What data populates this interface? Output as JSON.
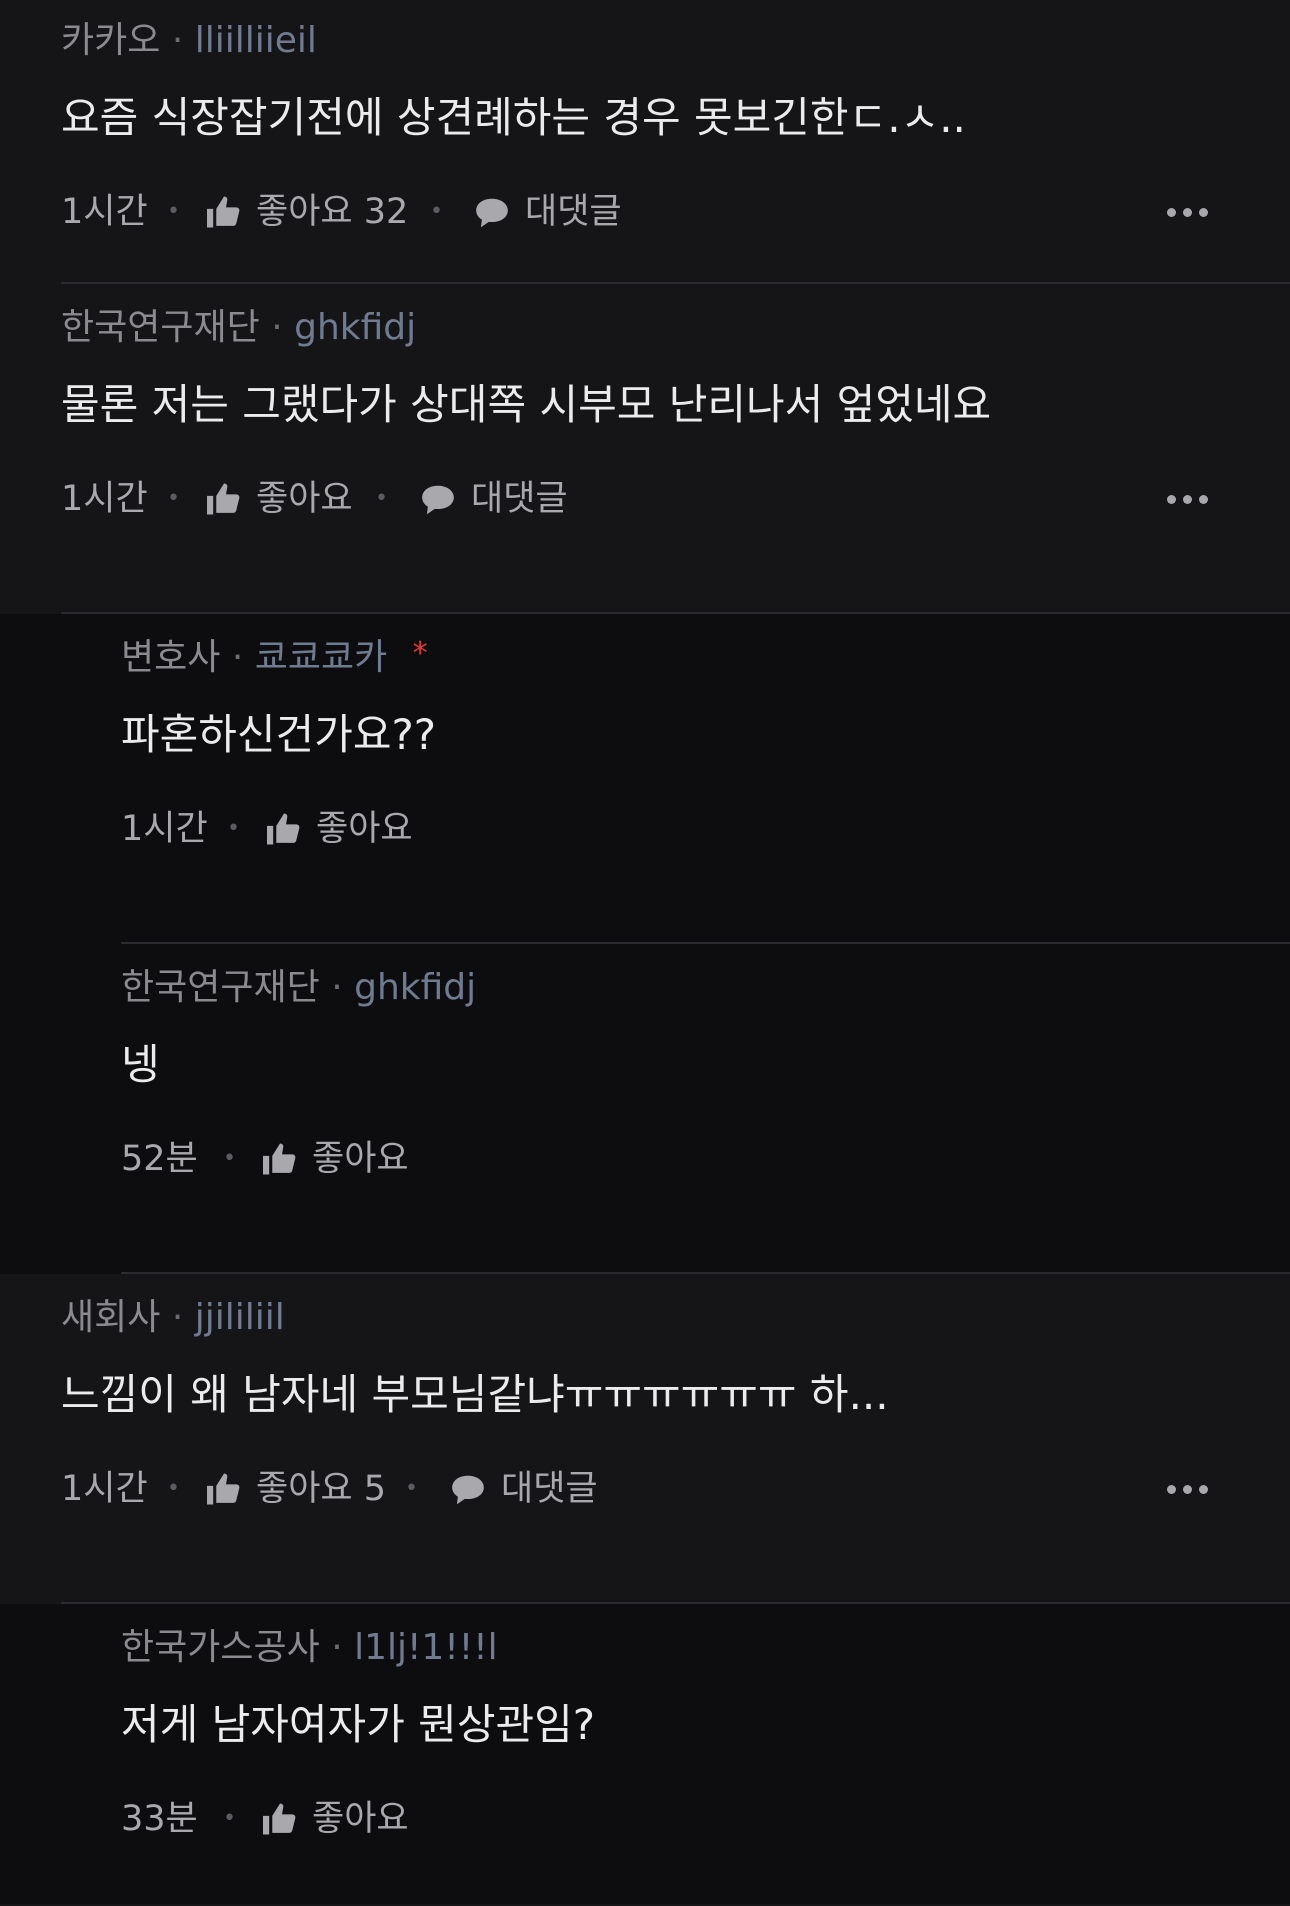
{
  "comments": [
    {
      "company": "카카오",
      "nickname": "lliilliieil",
      "text": "요즘 식장잡기전에 상견례하는 경우 못보긴한ㄷ.ㅅ..",
      "time": "1시간",
      "like_label": "좋아요 32",
      "reply_label": "대댓글"
    },
    {
      "company": "한국연구재단",
      "nickname": "ghkfidj",
      "text": "물론 저는 그랬다가 상대쪽 시부모 난리나서 엎었네요",
      "time": "1시간",
      "like_label": "좋아요",
      "reply_label": "대댓글"
    },
    {
      "company": "변호사",
      "nickname": "쿄쿄쿄카",
      "author_mark": "*",
      "text": "파혼하신건가요??",
      "time": "1시간",
      "like_label": "좋아요"
    },
    {
      "company": "한국연구재단",
      "nickname": "ghkfidj",
      "text": "넹",
      "time": "52분",
      "like_label": "좋아요"
    },
    {
      "company": "새회사",
      "nickname": "jjililiil",
      "text": "느낌이 왜 남자네 부모님같냐ㅠㅠㅠㅠㅠㅠ 하...",
      "time": "1시간",
      "like_label": "좋아요 5",
      "reply_label": "대댓글"
    },
    {
      "company": "한국가스공사",
      "nickname": "l1lj!1!!!l",
      "text": "저게 남자여자가 뭔상관임?",
      "time": "33분",
      "like_label": "좋아요"
    }
  ],
  "separator": "·",
  "icons": {
    "like": "thumbs-up-icon",
    "reply": "speech-bubble-icon",
    "more": "more-options-icon"
  }
}
